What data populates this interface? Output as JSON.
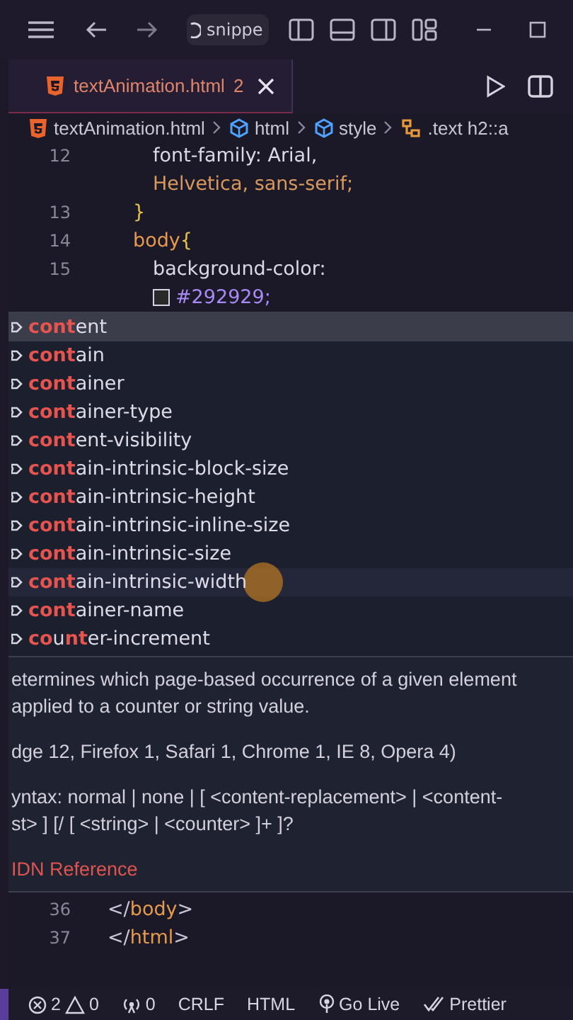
{
  "title_bar": {
    "search": {
      "value": "snippe"
    }
  },
  "tabs": [
    {
      "label": "textAnimation.html",
      "problems": "2",
      "selected": true
    }
  ],
  "breadcrumb": [
    {
      "kind": "file",
      "label": "textAnimation.html"
    },
    {
      "kind": "element",
      "label": "html"
    },
    {
      "kind": "element",
      "label": "style"
    },
    {
      "kind": "selector",
      "label": ".text h2::a"
    }
  ],
  "code_top": [
    {
      "number": "12",
      "kind": "declaration",
      "segments": [
        {
          "text": "font-family: Arial,",
          "kind": "prop"
        }
      ]
    },
    {
      "kind": "wrap",
      "segments": [
        {
          "text": "Helvetica, sans-serif;",
          "kind": "value"
        }
      ]
    },
    {
      "number": "13",
      "kind": "rule",
      "segments": [
        {
          "text": "}",
          "kind": "brace"
        }
      ]
    },
    {
      "number": "14",
      "kind": "rule",
      "segments": [
        {
          "text": "body",
          "kind": "selector"
        },
        {
          "text": "{",
          "kind": "brace"
        }
      ]
    },
    {
      "number": "15",
      "kind": "declaration",
      "segments": [
        {
          "text": "background-color:",
          "kind": "prop"
        }
      ]
    },
    {
      "kind": "wrap",
      "segments": [
        {
          "text": "#292929;",
          "kind": "color"
        }
      ]
    }
  ],
  "suggestions": [
    {
      "label": "**cont**ent",
      "selected": true
    },
    {
      "label": "**cont**ain",
      "selected": false
    },
    {
      "label": "**cont**ainer",
      "selected": false
    },
    {
      "label": "**cont**ainer-type",
      "selected": false
    },
    {
      "label": "**cont**ent-visibility",
      "selected": false
    },
    {
      "label": "**cont**ain-intrinsic-block-size",
      "selected": false
    },
    {
      "label": "**cont**ain-intrinsic-height",
      "selected": false
    },
    {
      "label": "**cont**ain-intrinsic-inline-size",
      "selected": false
    },
    {
      "label": "**cont**ain-intrinsic-size",
      "selected": false
    },
    {
      "label": "**cont**ain-intrinsic-width",
      "selected": false,
      "hovered": true
    },
    {
      "label": "**cont**ainer-name",
      "selected": false
    },
    {
      "label": "**co**u**nt**er-increment",
      "selected": false
    }
  ],
  "docs": {
    "description": [
      "etermines which page-based occurrence of a given element",
      "applied to a counter or string value."
    ],
    "support": "dge 12, Firefox 1, Safari 1, Chrome 1, IE 8, Opera 4)",
    "syntax": [
      "yntax: normal | none | [ <content-replacement> | <content-",
      "st> ] [/ [ <string> | <counter> ]+ ]?"
    ],
    "link": "IDN Reference"
  },
  "code_bottom": [
    {
      "number": "36",
      "kind": "element",
      "segments": [
        {
          "text": "</",
          "kind": "punct"
        },
        {
          "text": "body",
          "kind": "tag"
        },
        {
          "text": ">",
          "kind": "punct"
        }
      ]
    },
    {
      "number": "37",
      "kind": "element",
      "segments": [
        {
          "text": "</",
          "kind": "punct"
        },
        {
          "text": "html",
          "kind": "tag"
        },
        {
          "text": ">",
          "kind": "punct"
        }
      ]
    }
  ],
  "status_bar": {
    "errors": "2",
    "warnings": "0",
    "ports": "0",
    "eol": "CRLF",
    "language": "HTML",
    "live": "Go Live",
    "formatter": "Prettier"
  }
}
